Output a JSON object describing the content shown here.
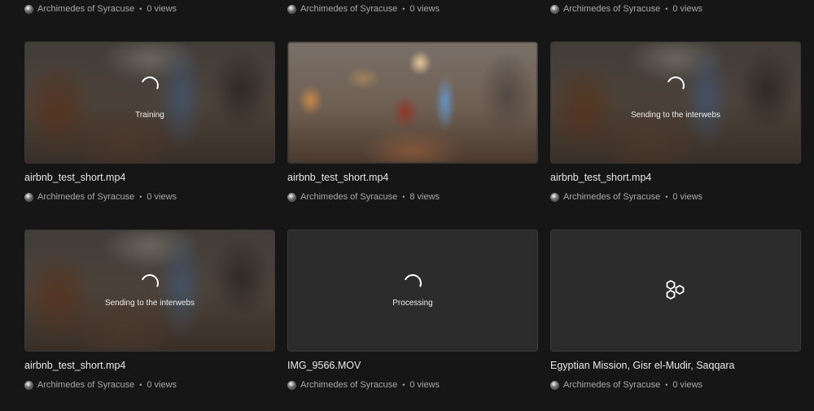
{
  "top_row": [
    {
      "author": "Archimedes of Syracuse",
      "views": "0 views"
    },
    {
      "author": "Archimedes of Syracuse",
      "views": "0 views"
    },
    {
      "author": "Archimedes of Syracuse",
      "views": "0 views"
    }
  ],
  "rows": [
    [
      {
        "title": "airbnb_test_short.mp4",
        "status": "Training",
        "author": "Archimedes of Syracuse",
        "views": "0 views"
      },
      {
        "title": "airbnb_test_short.mp4",
        "status": "",
        "author": "Archimedes of Syracuse",
        "views": "8 views"
      },
      {
        "title": "airbnb_test_short.mp4",
        "status": "Sending to the interwebs",
        "author": "Archimedes of Syracuse",
        "views": "0 views"
      }
    ],
    [
      {
        "title": "airbnb_test_short.mp4",
        "status": "Sending to the interwebs",
        "author": "Archimedes of Syracuse",
        "views": "0 views"
      },
      {
        "title": "IMG_9566.MOV",
        "status": "Processing",
        "author": "Archimedes of Syracuse",
        "views": "0 views"
      },
      {
        "title": "Egyptian Mission, Gisr el-Mudir, Saqqara",
        "status": "",
        "author": "Archimedes of Syracuse",
        "views": "0 views"
      }
    ]
  ],
  "separator": "•",
  "icons": {
    "spinner": "loading-spinner-icon",
    "placeholder": "hexagon-cluster-icon",
    "avatar": "author-avatar"
  },
  "colors": {
    "background": "#161616",
    "card": "#2b2b2b",
    "meta_text": "#a8a8a8"
  }
}
